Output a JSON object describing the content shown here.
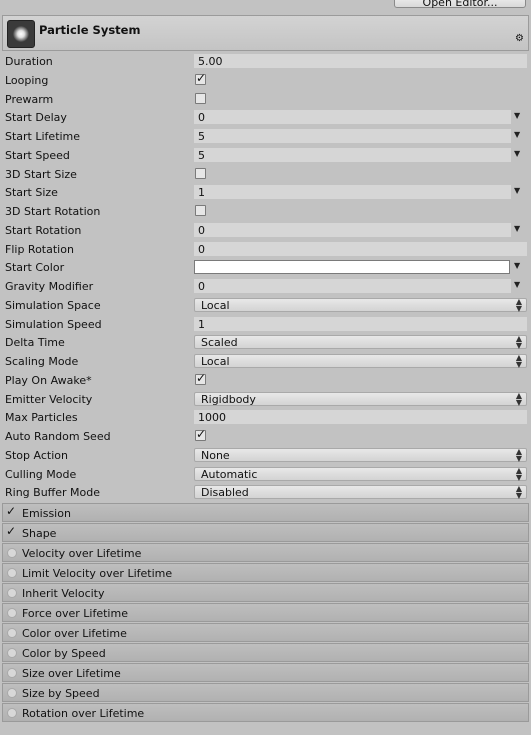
{
  "toolbar": {
    "open_editor_label": "Open Editor..."
  },
  "header": {
    "title": "Particle System",
    "icon": "particle-system-icon",
    "settings_glyph": "⚙"
  },
  "properties": [
    {
      "label": "Duration",
      "type": "text",
      "value": "5.00"
    },
    {
      "label": "Looping",
      "type": "checkbox",
      "checked": true
    },
    {
      "label": "Prewarm",
      "type": "checkbox",
      "checked": false
    },
    {
      "label": "Start Delay",
      "type": "number",
      "value": "0"
    },
    {
      "label": "Start Lifetime",
      "type": "number",
      "value": "5"
    },
    {
      "label": "Start Speed",
      "type": "number",
      "value": "5"
    },
    {
      "label": "3D Start Size",
      "type": "checkbox",
      "checked": false
    },
    {
      "label": "Start Size",
      "type": "number",
      "value": "1"
    },
    {
      "label": "3D Start Rotation",
      "type": "checkbox",
      "checked": false
    },
    {
      "label": "Start Rotation",
      "type": "number",
      "value": "0"
    },
    {
      "label": "Flip Rotation",
      "type": "text",
      "value": "0"
    },
    {
      "label": "Start Color",
      "type": "color",
      "value": "#ffffff"
    },
    {
      "label": "Gravity Modifier",
      "type": "number",
      "value": "0"
    },
    {
      "label": "Simulation Space",
      "type": "popup",
      "value": "Local"
    },
    {
      "label": "Simulation Speed",
      "type": "text",
      "value": "1"
    },
    {
      "label": "Delta Time",
      "type": "popup",
      "value": "Scaled"
    },
    {
      "label": "Scaling Mode",
      "type": "popup",
      "value": "Local"
    },
    {
      "label": "Play On Awake*",
      "type": "checkbox",
      "checked": true
    },
    {
      "label": "Emitter Velocity",
      "type": "popup",
      "value": "Rigidbody"
    },
    {
      "label": "Max Particles",
      "type": "text",
      "value": "1000"
    },
    {
      "label": "Auto Random Seed",
      "type": "checkbox",
      "checked": true
    },
    {
      "label": "Stop Action",
      "type": "popup",
      "value": "None"
    },
    {
      "label": "Culling Mode",
      "type": "popup",
      "value": "Automatic"
    },
    {
      "label": "Ring Buffer Mode",
      "type": "popup",
      "value": "Disabled"
    }
  ],
  "modules": [
    {
      "label": "Emission",
      "enabled": true
    },
    {
      "label": "Shape",
      "enabled": true
    },
    {
      "label": "Velocity over Lifetime",
      "enabled": false
    },
    {
      "label": "Limit Velocity over Lifetime",
      "enabled": false
    },
    {
      "label": "Inherit Velocity",
      "enabled": false
    },
    {
      "label": "Force over Lifetime",
      "enabled": false
    },
    {
      "label": "Color over Lifetime",
      "enabled": false
    },
    {
      "label": "Color by Speed",
      "enabled": false
    },
    {
      "label": "Size over Lifetime",
      "enabled": false
    },
    {
      "label": "Size by Speed",
      "enabled": false
    },
    {
      "label": "Rotation over Lifetime",
      "enabled": false
    }
  ]
}
